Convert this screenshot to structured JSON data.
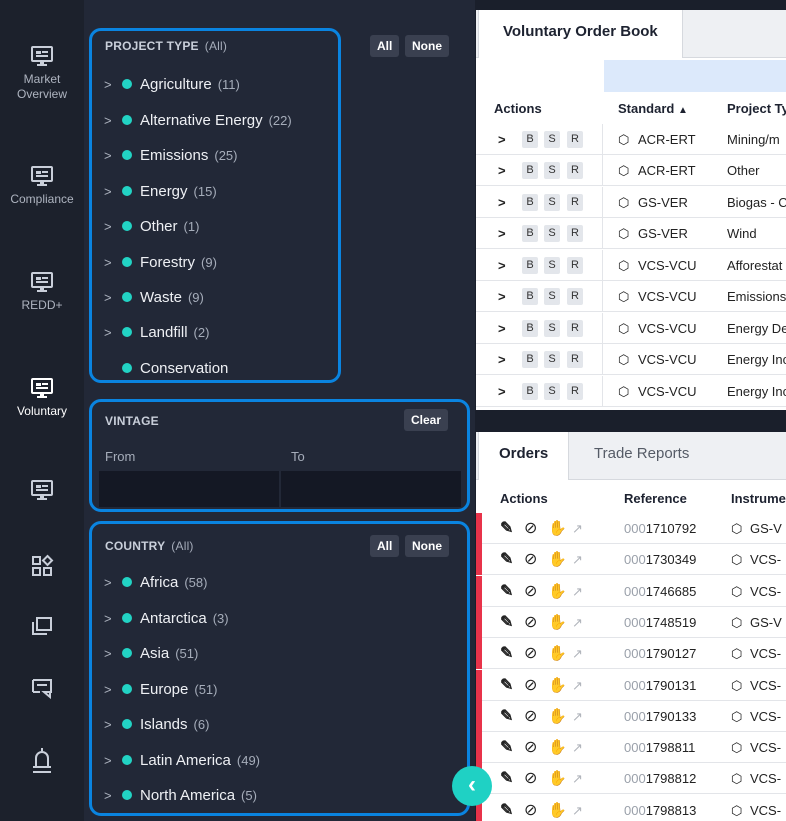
{
  "nav": {
    "items": [
      {
        "label_lines": [
          "Market",
          "Overview"
        ]
      },
      {
        "label_lines": [
          "Compliance"
        ]
      },
      {
        "label_lines": [
          "REDD+"
        ]
      },
      {
        "label_lines": [
          "Voluntary"
        ]
      }
    ],
    "icon_items": [
      "monitor-icon",
      "grid-icon",
      "windows-icon",
      "chat-icon",
      "bell-icon"
    ]
  },
  "project_type": {
    "title": "PROJECT TYPE",
    "filter_state": "(All)",
    "all_label": "All",
    "none_label": "None",
    "items": [
      {
        "label": "Agriculture",
        "count": "(11)"
      },
      {
        "label": "Alternative Energy",
        "count": "(22)"
      },
      {
        "label": "Emissions",
        "count": "(25)"
      },
      {
        "label": "Energy",
        "count": "(15)"
      },
      {
        "label": "Other",
        "count": "(1)"
      },
      {
        "label": "Forestry",
        "count": "(9)"
      },
      {
        "label": "Waste",
        "count": "(9)"
      },
      {
        "label": "Landfill",
        "count": "(2)"
      },
      {
        "label": "Conservation",
        "count": ""
      }
    ]
  },
  "vintage": {
    "title": "VINTAGE",
    "clear_label": "Clear",
    "from_label": "From",
    "to_label": "To"
  },
  "country": {
    "title": "COUNTRY",
    "filter_state": "(All)",
    "all_label": "All",
    "none_label": "None",
    "items": [
      {
        "label": "Africa",
        "count": "(58)"
      },
      {
        "label": "Antarctica",
        "count": "(3)"
      },
      {
        "label": "Asia",
        "count": "(51)"
      },
      {
        "label": "Europe",
        "count": "(51)"
      },
      {
        "label": "Islands",
        "count": "(6)"
      },
      {
        "label": "Latin America",
        "count": "(49)"
      },
      {
        "label": "North America",
        "count": "(5)"
      }
    ]
  },
  "order_book": {
    "tab_label": "Voluntary Order Book",
    "headers": {
      "actions": "Actions",
      "standard": "Standard",
      "project_type": "Project Ty"
    },
    "buttons": [
      "B",
      "S",
      "R"
    ],
    "rows": [
      {
        "standard": "ACR-ERT",
        "project_type": "Mining/m"
      },
      {
        "standard": "ACR-ERT",
        "project_type": "Other"
      },
      {
        "standard": "GS-VER",
        "project_type": "Biogas - C"
      },
      {
        "standard": "GS-VER",
        "project_type": "Wind"
      },
      {
        "standard": "VCS-VCU",
        "project_type": "Afforestat"
      },
      {
        "standard": "VCS-VCU",
        "project_type": "Emissions"
      },
      {
        "standard": "VCS-VCU",
        "project_type": "Energy De"
      },
      {
        "standard": "VCS-VCU",
        "project_type": "Energy Inc"
      },
      {
        "standard": "VCS-VCU",
        "project_type": "Energy Inc"
      }
    ]
  },
  "orders": {
    "tabs": [
      "Orders",
      "Trade Reports"
    ],
    "headers": {
      "actions": "Actions",
      "reference": "Reference",
      "instrument": "Instrumer"
    },
    "rows": [
      {
        "ref_prefix": "000",
        "ref_main": "1710792",
        "instrument": "GS-V"
      },
      {
        "ref_prefix": "000",
        "ref_main": "1730349",
        "instrument": "VCS-"
      },
      {
        "ref_prefix": "000",
        "ref_main": "1746685",
        "instrument": "VCS-"
      },
      {
        "ref_prefix": "000",
        "ref_main": "1748519",
        "instrument": "GS-V"
      },
      {
        "ref_prefix": "000",
        "ref_main": "1790127",
        "instrument": "VCS-"
      },
      {
        "ref_prefix": "000",
        "ref_main": "1790131",
        "instrument": "VCS-"
      },
      {
        "ref_prefix": "000",
        "ref_main": "1790133",
        "instrument": "VCS-"
      },
      {
        "ref_prefix": "000",
        "ref_main": "1798811",
        "instrument": "VCS-"
      },
      {
        "ref_prefix": "000",
        "ref_main": "1798812",
        "instrument": "VCS-"
      },
      {
        "ref_prefix": "000",
        "ref_main": "1798813",
        "instrument": "VCS-"
      }
    ]
  },
  "colors": {
    "accent_blue": "#0a84e0",
    "teal": "#22d3c4",
    "order_red": "#e8334a"
  }
}
